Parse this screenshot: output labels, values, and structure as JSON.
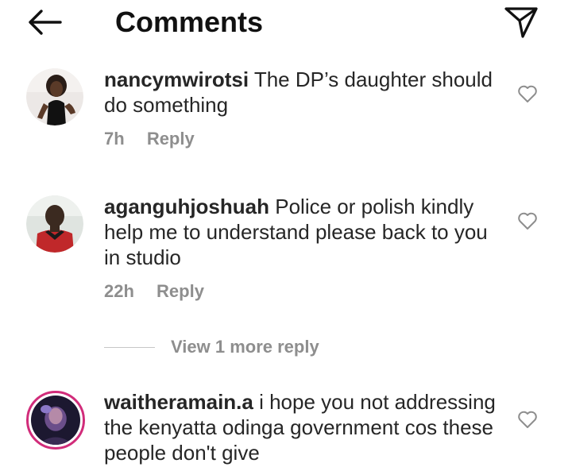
{
  "header": {
    "back_icon": "arrow-left-icon",
    "title": "Comments",
    "share_icon": "paper-plane-icon"
  },
  "comments": [
    {
      "username": "nancymwirotsi",
      "text": "The DP’s daughter should do something",
      "time": "7h",
      "reply_label": "Reply",
      "like_icon": "heart-outline-icon"
    },
    {
      "username": "aganguhjoshuah",
      "text": "Police or polish kindly help me to understand please back to you in studio",
      "time": "22h",
      "reply_label": "Reply",
      "like_icon": "heart-outline-icon",
      "view_more_replies": "View 1 more reply"
    },
    {
      "username": "waitheramain.a",
      "text": "i hope you not addressing the kenyatta odinga government cos these people don't give",
      "like_icon": "heart-outline-icon",
      "story_ring_color": "#d12c7a"
    }
  ]
}
